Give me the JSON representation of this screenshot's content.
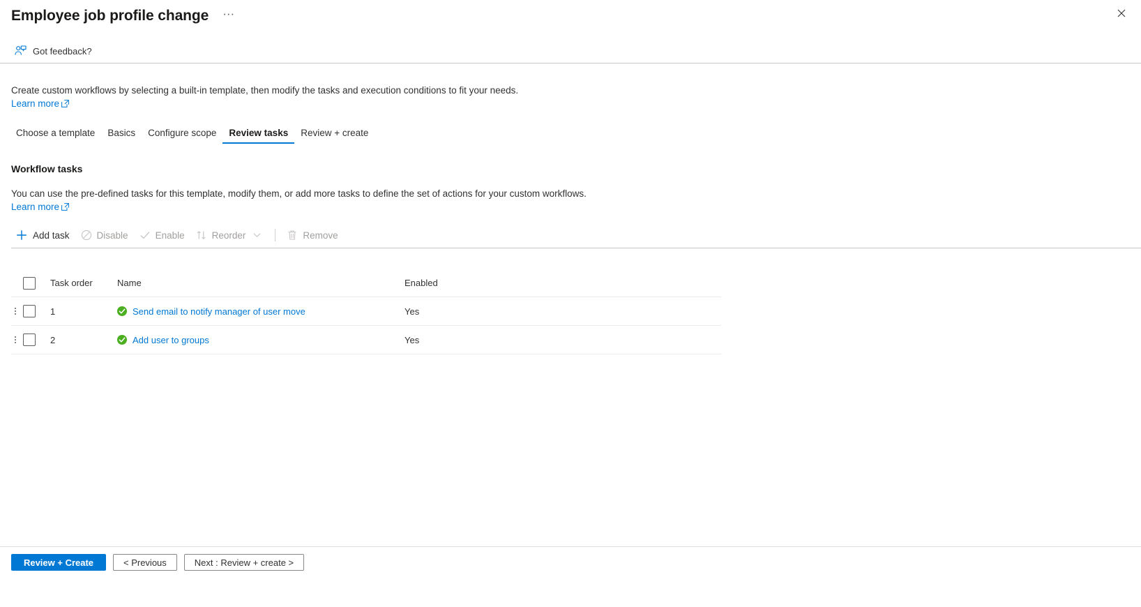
{
  "blade": {
    "title": "Employee job profile change",
    "more_label": "···",
    "close_icon": "close-icon"
  },
  "feedback": {
    "label": "Got feedback?",
    "icon": "feedback-person-icon"
  },
  "intro": {
    "description": "Create custom workflows by selecting a built-in template, then modify the tasks and execution conditions to fit your needs.",
    "learn_more": "Learn more"
  },
  "tabs": [
    {
      "label": "Choose a template",
      "active": false
    },
    {
      "label": "Basics",
      "active": false
    },
    {
      "label": "Configure scope",
      "active": false
    },
    {
      "label": "Review tasks",
      "active": true
    },
    {
      "label": "Review + create",
      "active": false
    }
  ],
  "section": {
    "title": "Workflow tasks",
    "description": "You can use the pre-defined tasks for this template, modify them, or add more tasks to define the set of actions for your custom workflows.",
    "learn_more": "Learn more"
  },
  "commands": [
    {
      "label": "Add task",
      "icon": "plus-icon",
      "disabled": false
    },
    {
      "label": "Disable",
      "icon": "block-circle-icon",
      "disabled": true
    },
    {
      "label": "Enable",
      "icon": "checkmark-icon",
      "disabled": true
    },
    {
      "label": "Reorder",
      "icon": "sort-arrows-icon",
      "disabled": true,
      "has_chevron": true
    },
    {
      "label": "Remove",
      "icon": "trash-icon",
      "disabled": true
    }
  ],
  "table": {
    "headers": {
      "task_order": "Task order",
      "name": "Name",
      "enabled": "Enabled"
    },
    "rows": [
      {
        "order": "1",
        "name": "Send email to notify manager of user move",
        "enabled": "Yes",
        "status_icon": "green-check-icon"
      },
      {
        "order": "2",
        "name": "Add user to groups",
        "enabled": "Yes",
        "status_icon": "green-check-icon"
      }
    ]
  },
  "footer": {
    "review_create": "Review + Create",
    "previous": "< Previous",
    "next": "Next : Review + create >"
  },
  "colors": {
    "accent": "#0078d4",
    "link": "#0078d4",
    "success": "#4caf22",
    "text": "#323130",
    "disabled": "#a19f9d",
    "divider": "#c8c6c4"
  }
}
